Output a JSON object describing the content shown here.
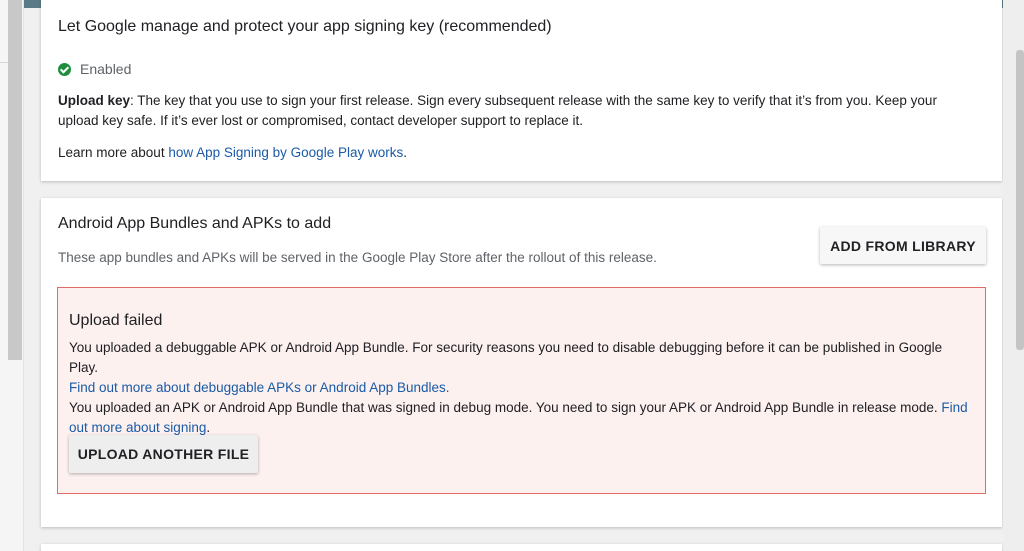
{
  "signing": {
    "title": "Let Google manage and protect your app signing key (recommended)",
    "status": "Enabled",
    "upload_key_label": "Upload key",
    "upload_key_text": ": The key that you use to sign your first release. Sign every subsequent release with the same key to verify that it’s from you. Keep your upload key safe. If it’s ever lost or compromised, contact developer support to replace it.",
    "learn_more_prefix": "Learn more about ",
    "learn_more_link": "how App Signing by Google Play works",
    "learn_more_suffix": "."
  },
  "bundles": {
    "title": "Android App Bundles and APKs to add",
    "subtitle": "These app bundles and APKs will be served in the Google Play Store after the rollout of this release.",
    "add_button": "ADD FROM LIBRARY",
    "error": {
      "title": "Upload failed",
      "line1": "You uploaded a debuggable APK or Android App Bundle. For security reasons you need to disable debugging before it can be published in Google Play.",
      "link1": "Find out more about debuggable APKs or Android App Bundles.",
      "line2": "You uploaded an APK or Android App Bundle that was signed in debug mode. You need to sign your APK or Android App Bundle in release mode. ",
      "link2": "Find out more about signing",
      "line2_suffix": ".",
      "upload_button": "UPLOAD ANOTHER FILE"
    }
  },
  "colors": {
    "link": "#1a5aa6",
    "success": "#1e8e3e",
    "error_border": "#e06a66",
    "error_bg": "#fdf1f0",
    "header": "#5a7a85"
  }
}
